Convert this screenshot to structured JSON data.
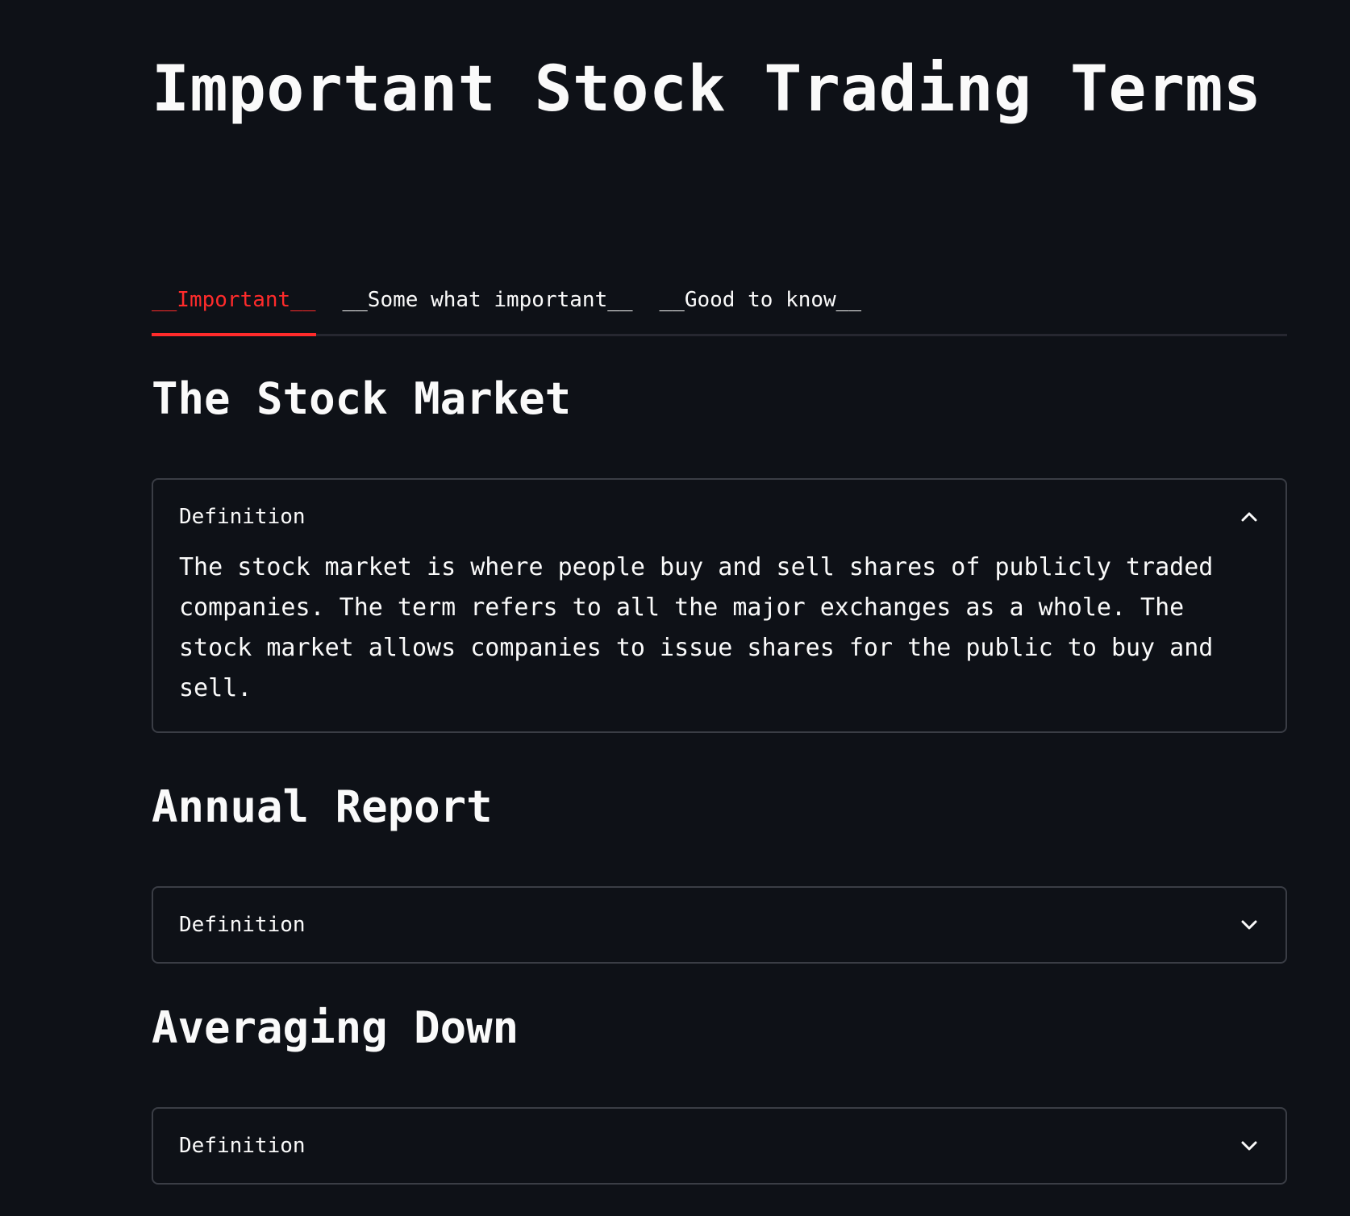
{
  "page": {
    "title": "Important Stock Trading Terms"
  },
  "tabs": [
    {
      "label": "__Important__",
      "active": true
    },
    {
      "label": "__Some what important__",
      "active": false
    },
    {
      "label": "__Good to know__",
      "active": false
    }
  ],
  "sections": [
    {
      "heading": "The Stock Market",
      "expander": {
        "label": "Definition",
        "expanded": true,
        "icon": "chevron-up-icon",
        "body": "The stock market is where people buy and sell shares of publicly traded companies. The term refers to all the major exchanges as a whole. The stock market allows companies to issue shares for the public to buy and sell."
      }
    },
    {
      "heading": "Annual Report",
      "expander": {
        "label": "Definition",
        "expanded": false,
        "icon": "chevron-down-icon"
      }
    },
    {
      "heading": "Averaging Down",
      "expander": {
        "label": "Definition",
        "expanded": false,
        "icon": "chevron-down-icon"
      }
    }
  ],
  "colors": {
    "background": "#0e1117",
    "text": "#fafafa",
    "accent": "#ff2b2b",
    "border": "#3a3d45"
  }
}
